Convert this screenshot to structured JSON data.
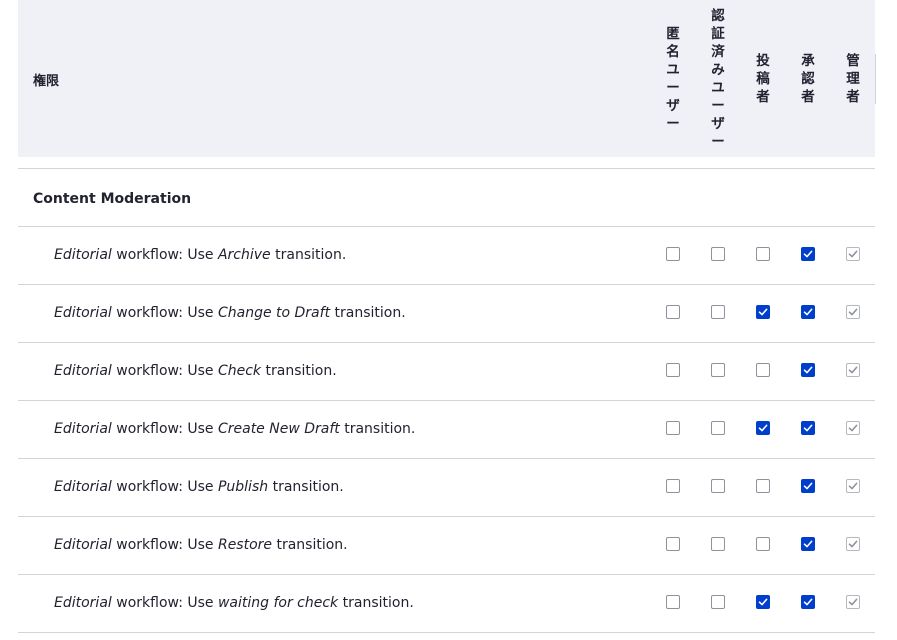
{
  "header": {
    "permission_label": "権限",
    "roles": [
      {
        "label": "匿名ユーザー",
        "chars": [
          "匿",
          "名",
          "ユ",
          "ー",
          "ザ",
          "ー"
        ]
      },
      {
        "label": "認証済みユーザー",
        "chars": [
          "認",
          "証",
          "済",
          "み",
          "ユ",
          "ー",
          "ザ",
          "ー"
        ]
      },
      {
        "label": "投稿者",
        "chars": [
          "投",
          "稿",
          "者"
        ]
      },
      {
        "label": "承認者",
        "chars": [
          "承",
          "認",
          "者"
        ]
      },
      {
        "label": "管理者",
        "chars": [
          "管",
          "理",
          "者"
        ]
      }
    ]
  },
  "section": {
    "title": "Content Moderation"
  },
  "rows": [
    {
      "prefix": "Editorial",
      "middle": " workflow: Use ",
      "transition": "Archive",
      "suffix": " transition.",
      "checks": [
        false,
        false,
        false,
        true,
        true
      ]
    },
    {
      "prefix": "Editorial",
      "middle": " workflow: Use ",
      "transition": "Change to Draft",
      "suffix": " transition.",
      "checks": [
        false,
        false,
        true,
        true,
        true
      ]
    },
    {
      "prefix": "Editorial",
      "middle": " workflow: Use ",
      "transition": "Check",
      "suffix": " transition.",
      "checks": [
        false,
        false,
        false,
        true,
        true
      ]
    },
    {
      "prefix": "Editorial",
      "middle": " workflow: Use ",
      "transition": "Create New Draft",
      "suffix": " transition.",
      "checks": [
        false,
        false,
        true,
        true,
        true
      ]
    },
    {
      "prefix": "Editorial",
      "middle": " workflow: Use ",
      "transition": "Publish",
      "suffix": " transition.",
      "checks": [
        false,
        false,
        false,
        true,
        true
      ]
    },
    {
      "prefix": "Editorial",
      "middle": " workflow: Use ",
      "transition": "Restore",
      "suffix": " transition.",
      "checks": [
        false,
        false,
        false,
        true,
        true
      ]
    },
    {
      "prefix": "Editorial",
      "middle": " workflow: Use ",
      "transition": "waiting for check",
      "suffix": " transition.",
      "checks": [
        false,
        false,
        true,
        true,
        true
      ]
    }
  ],
  "colors": {
    "checked": "#003ecc",
    "disabled_check": "#8e929c",
    "header_bg": "#f0f1f6",
    "border": "#d4d4d8"
  }
}
